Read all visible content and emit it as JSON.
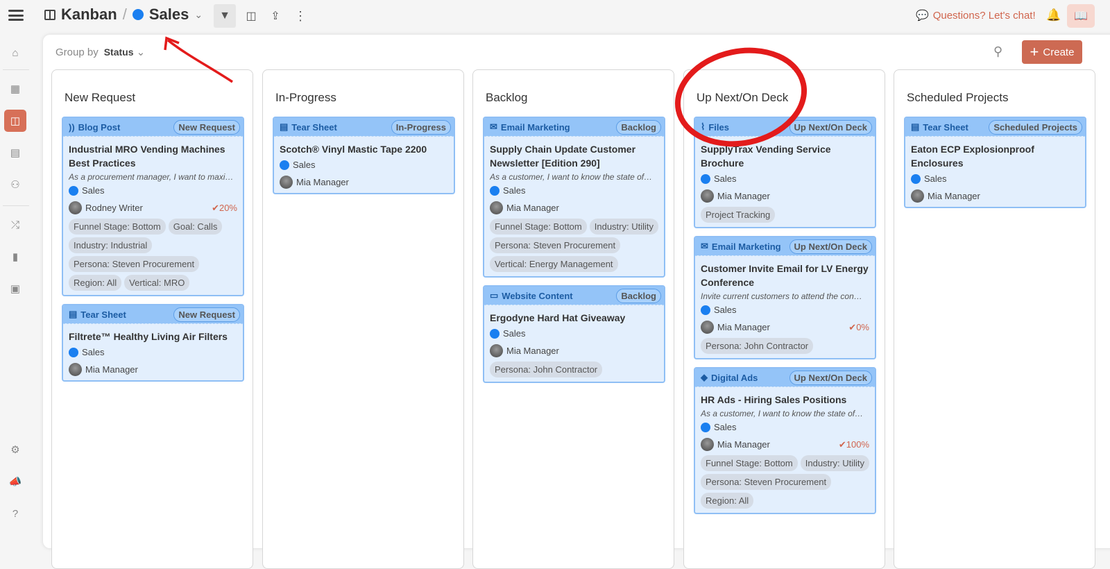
{
  "topbar": {
    "view": "Kanban",
    "separator": "/",
    "board": "Sales",
    "chat": "Questions? Let's chat!"
  },
  "toolbar": {
    "group_by_label": "Group by",
    "group_by_value": "Status",
    "create_label": "Create"
  },
  "colors": {
    "accent": "#cd6a53",
    "sales_dot": "#1a7ff0",
    "card_header": "#94c4f8"
  },
  "columns": [
    {
      "title": "New Request",
      "cards": [
        {
          "type": "Blog Post",
          "icon": "rss",
          "status": "New Request",
          "title": "Industrial MRO Vending Machines Best Practices",
          "desc": "As a procurement manager, I want to maximize…",
          "tag": "Sales",
          "user": "Rodney Writer",
          "progress": "20%",
          "chips": [
            "Funnel Stage: Bottom",
            "Goal: Calls",
            "Industry: Industrial",
            "Persona: Steven Procurement",
            "Region: All",
            "Vertical: MRO"
          ]
        },
        {
          "type": "Tear Sheet",
          "icon": "doc",
          "status": "New Request",
          "title": "Filtrete™ Healthy Living Air Filters",
          "tag": "Sales",
          "user": "Mia Manager",
          "chips": []
        }
      ]
    },
    {
      "title": "In-Progress",
      "cards": [
        {
          "type": "Tear Sheet",
          "icon": "doc",
          "status": "In-Progress",
          "title": "Scotch® Vinyl Mastic Tape 2200",
          "tag": "Sales",
          "user": "Mia Manager",
          "chips": []
        }
      ]
    },
    {
      "title": "Backlog",
      "cards": [
        {
          "type": "Email Marketing",
          "icon": "mail",
          "status": "Backlog",
          "title": "Supply Chain Update Customer Newsletter [Edition 290]",
          "desc": "As a customer, I want to know the state of…",
          "tag": "Sales",
          "user": "Mia Manager",
          "chips": [
            "Funnel Stage: Bottom",
            "Industry: Utility",
            "Persona: Steven Procurement",
            "Vertical: Energy Management"
          ]
        },
        {
          "type": "Website Content",
          "icon": "monitor",
          "status": "Backlog",
          "title": "Ergodyne Hard Hat Giveaway",
          "tag": "Sales",
          "user": "Mia Manager",
          "chips": [
            "Persona: John Contractor"
          ]
        }
      ]
    },
    {
      "title": "Up Next/On Deck",
      "cards": [
        {
          "type": "Files",
          "icon": "clip",
          "status": "Up Next/On Deck",
          "title": "SupplyTrax Vending Service Brochure",
          "tag": "Sales",
          "user": "Mia Manager",
          "chips": [
            "Project Tracking"
          ]
        },
        {
          "type": "Email Marketing",
          "icon": "mail",
          "status": "Up Next/On Deck",
          "title": "Customer Invite Email for LV Energy Conference",
          "desc": "Invite current customers to attend the con…",
          "tag": "Sales",
          "user": "Mia Manager",
          "progress": "0%",
          "chips": [
            "Persona: John Contractor"
          ]
        },
        {
          "type": "Digital Ads",
          "icon": "tag",
          "status": "Up Next/On Deck",
          "title": "HR Ads - Hiring Sales Positions",
          "desc": "As a customer, I want to know the state of…",
          "tag": "Sales",
          "user": "Mia Manager",
          "progress": "100%",
          "chips": [
            "Funnel Stage: Bottom",
            "Industry: Utility",
            "Persona: Steven Procurement",
            "Region: All"
          ]
        }
      ]
    },
    {
      "title": "Scheduled Projects",
      "cards": [
        {
          "type": "Tear Sheet",
          "icon": "doc",
          "status": "Scheduled Projects",
          "title": "Eaton ECP Explosionproof Enclosures",
          "tag": "Sales",
          "user": "Mia Manager",
          "chips": []
        }
      ]
    }
  ]
}
